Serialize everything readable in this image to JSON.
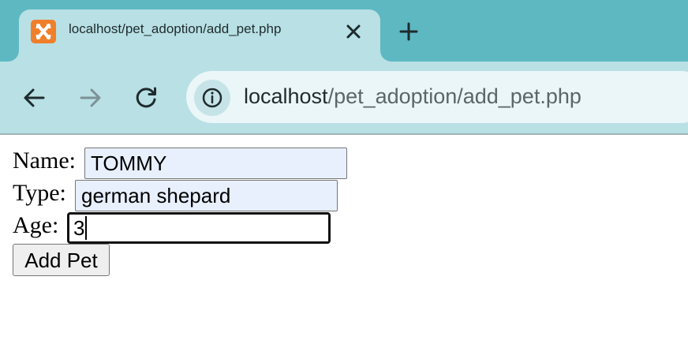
{
  "browser": {
    "tab": {
      "title": "localhost/pet_adoption/add_pet.php",
      "favicon": "xampp-icon"
    },
    "address_bar": {
      "host": "localhost",
      "path": "/pet_adoption/add_pet.php"
    },
    "colors": {
      "tab_strip": "#5db8c2",
      "toolbar": "#b8e0e5",
      "omnibox": "#eaf6f7",
      "favicon": "#f07f2b"
    }
  },
  "form": {
    "fields": [
      {
        "label": "Name:",
        "value": "TOMMY",
        "autofilled": true
      },
      {
        "label": "Type:",
        "value": "german shepard",
        "autofilled": true
      },
      {
        "label": "Age:",
        "value": "3",
        "focused": true
      }
    ],
    "submit_label": "Add Pet"
  }
}
